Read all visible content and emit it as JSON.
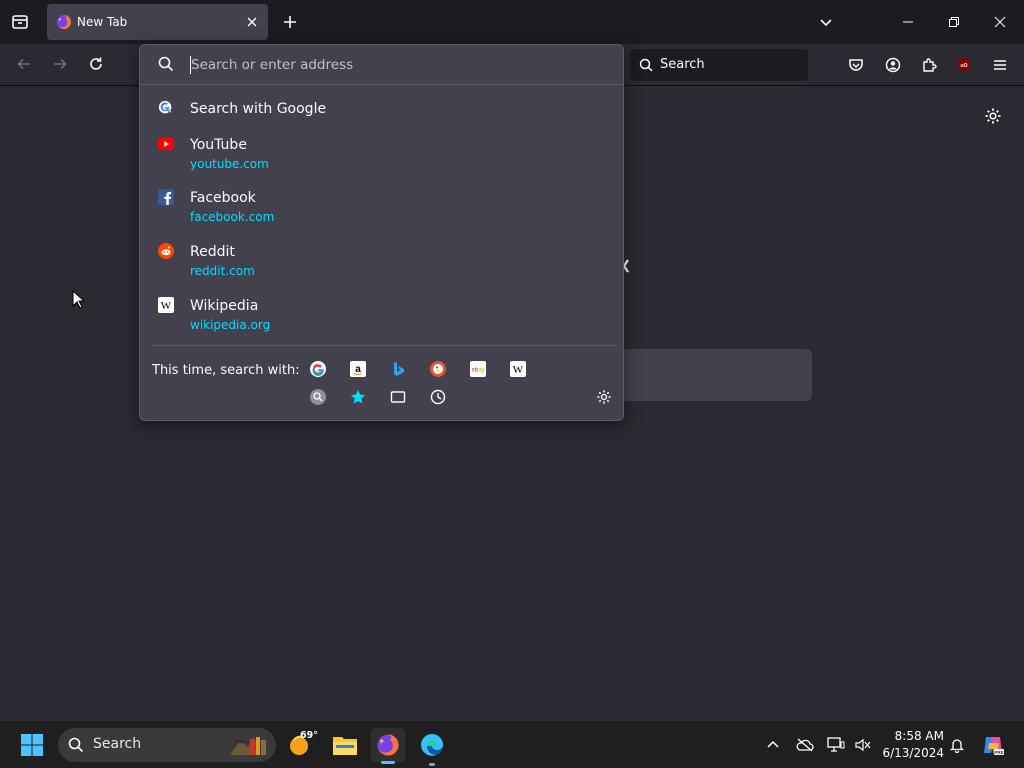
{
  "tab": {
    "title": "New Tab"
  },
  "urlbar": {
    "placeholder": "Search or enter address",
    "results": [
      {
        "title": "Search with Google",
        "url": "",
        "icon": "google-search-icon"
      },
      {
        "title": "YouTube",
        "url": "youtube.com",
        "icon": "youtube-icon"
      },
      {
        "title": "Facebook",
        "url": "facebook.com",
        "icon": "facebook-icon"
      },
      {
        "title": "Reddit",
        "url": "reddit.com",
        "icon": "reddit-icon"
      },
      {
        "title": "Wikipedia",
        "url": "wikipedia.org",
        "icon": "wikipedia-icon"
      }
    ],
    "one_off": {
      "label": "This time, search with:",
      "engines": [
        "Google",
        "Amazon",
        "Bing",
        "DuckDuckGo",
        "eBay",
        "Wikipedia",
        "Search",
        "Bookmarks",
        "Tabs",
        "History"
      ]
    }
  },
  "searchbar": {
    "placeholder": "Search"
  },
  "taskbar": {
    "search_text": "Search",
    "weather_temp": "69°",
    "time": "8:58 AM",
    "date": "6/13/2024"
  },
  "colors": {
    "accent": "#00ddff",
    "panel": "#42414d",
    "background": "#1c1b22"
  }
}
